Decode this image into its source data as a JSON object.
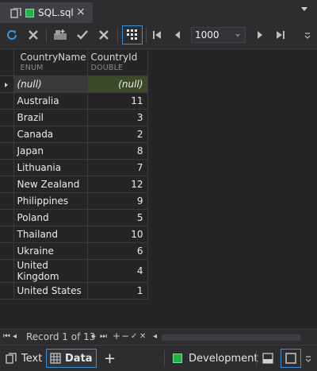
{
  "tab": {
    "title": "SQL.sql",
    "close_glyph": "×",
    "db_color": "#22b14c"
  },
  "toolbar": {
    "page_size": "1000",
    "icons": [
      "refresh-icon",
      "cancel-icon",
      "insert-row-icon",
      "commit-icon",
      "rollback-icon",
      "grid-view-icon",
      "first-page-icon",
      "previous-page-icon",
      "next-page-icon",
      "last-page-icon",
      "toolbar-overflow-icon"
    ]
  },
  "grid": {
    "columns": [
      {
        "name": "CountryName",
        "type": "ENUM"
      },
      {
        "name": "CountryId",
        "type": "DOUBLE"
      }
    ],
    "rows": [
      [
        "(null)",
        "(null)"
      ],
      [
        "Australia",
        "11"
      ],
      [
        "Brazil",
        "3"
      ],
      [
        "Canada",
        "2"
      ],
      [
        "Japan",
        "8"
      ],
      [
        "Lithuania",
        "7"
      ],
      [
        "New Zealand",
        "12"
      ],
      [
        "Philippines",
        "9"
      ],
      [
        "Poland",
        "5"
      ],
      [
        "Thailand",
        "10"
      ],
      [
        "Ukraine",
        "6"
      ],
      [
        "United Kingdom",
        "4"
      ],
      [
        "United States",
        "1"
      ]
    ]
  },
  "status": {
    "record_label": "Record 1 of 13",
    "nav": {
      "first": "⏮",
      "prev": "◂",
      "next": "▸",
      "last": "⏭",
      "add": "+",
      "remove": "−",
      "post": "✓",
      "cancel": "✕"
    }
  },
  "bottom": {
    "text_label": "Text",
    "data_label": "Data",
    "add_label": "+",
    "connection_label": "Development",
    "connection_color": "#22b14c"
  }
}
